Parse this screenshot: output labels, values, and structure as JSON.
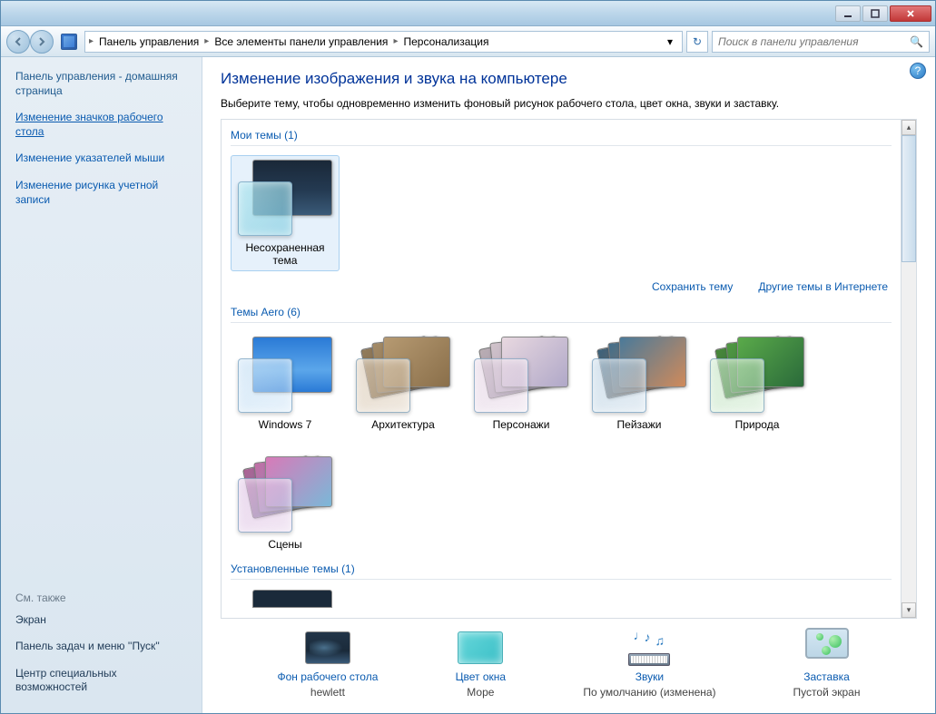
{
  "breadcrumb": {
    "part1": "Панель управления",
    "part2": "Все элементы панели управления",
    "part3": "Персонализация"
  },
  "search": {
    "placeholder": "Поиск в панели управления"
  },
  "sidebar": {
    "home": "Панель управления - домашняя страница",
    "links": {
      "desktop_icons": "Изменение значков рабочего стола",
      "mouse_pointers": "Изменение указателей мыши",
      "account_picture": "Изменение рисунка учетной записи"
    },
    "see_also_heading": "См. также",
    "see_also": {
      "display": "Экран",
      "taskbar": "Панель задач и меню ''Пуск''",
      "ease": "Центр специальных возможностей"
    }
  },
  "page": {
    "title": "Изменение изображения и звука на компьютере",
    "desc": "Выберите тему, чтобы одновременно изменить фоновый рисунок рабочего стола, цвет окна, звуки и заставку."
  },
  "sections": {
    "my_themes": "Мои темы (1)",
    "aero_themes": "Темы Aero (6)",
    "installed_themes": "Установленные темы (1)"
  },
  "themes": {
    "unsaved": "Несохраненная тема",
    "aero": [
      "Windows 7",
      "Архитектура",
      "Персонажи",
      "Пейзажи",
      "Природа",
      "Сцены"
    ]
  },
  "actions": {
    "save": "Сохранить тему",
    "more": "Другие темы в Интернете"
  },
  "bottom": {
    "bg": {
      "title": "Фон рабочего стола",
      "value": "hewlett"
    },
    "color": {
      "title": "Цвет окна",
      "value": "Море"
    },
    "sound": {
      "title": "Звуки",
      "value": "По умолчанию (изменена)"
    },
    "saver": {
      "title": "Заставка",
      "value": "Пустой экран"
    }
  },
  "theme_colors": {
    "w7": "linear-gradient(180deg,#2a7ad6 0%,#5ba6ea 60%,#2a7ad6 100%)",
    "arch": "linear-gradient(135deg,#b69a72,#8a6f4a)",
    "char": "linear-gradient(135deg,#e8d8e0,#b0a8c8)",
    "land": "linear-gradient(135deg,#4a7a9a,#d08a5a)",
    "nature": "linear-gradient(135deg,#5aaa4a,#2a6a3a)",
    "scenes": "linear-gradient(135deg,#d87ab8,#7ab8d8)"
  }
}
